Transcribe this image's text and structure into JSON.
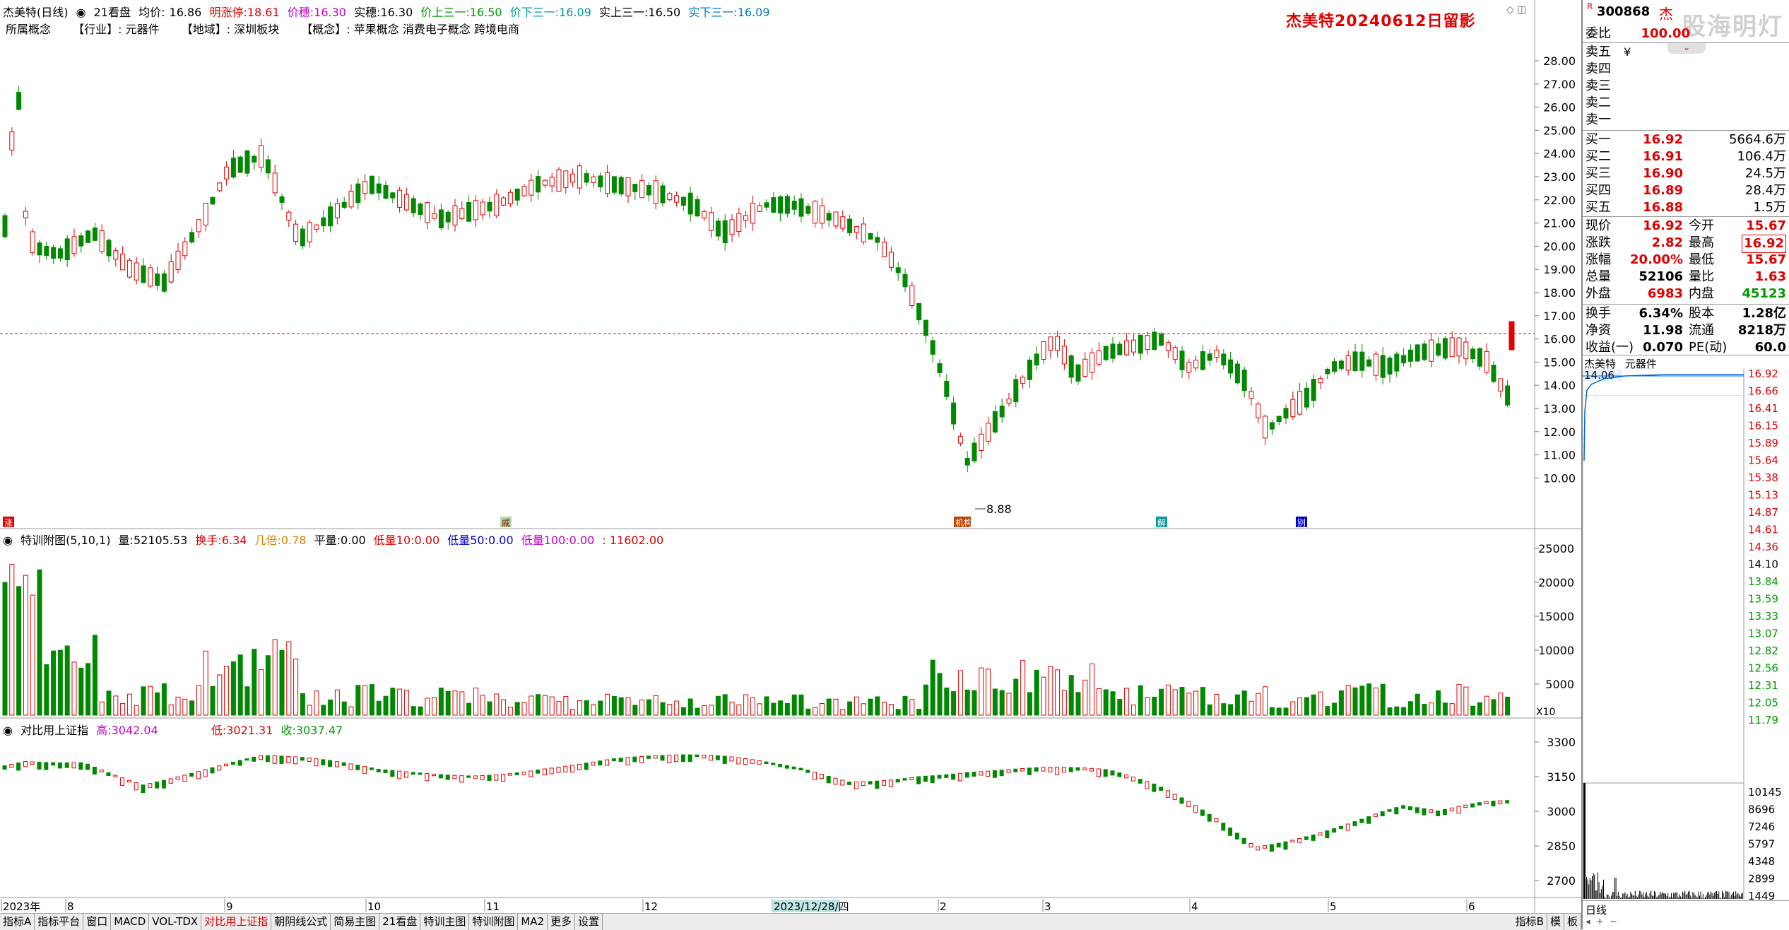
{
  "header": {
    "name": "杰美特(日线)",
    "tabs": "21看盘",
    "avg_label": "均价:",
    "avg": "16.86",
    "limit_label": "明涨停:",
    "limit": "18.61",
    "price_label": "价穗:",
    "price": "16.30",
    "real_label": "实穗:",
    "real": "16.30",
    "up3_label": "价上三一:",
    "up3": "16.50",
    "down3_label": "价下三一:",
    "down3": "16.09",
    "rup3_label": "实上三一:",
    "rup3": "16.50",
    "rdown3_label": "实下三一:",
    "rdown3": "16.09"
  },
  "info_tags": {
    "concept_tag": "所属概念",
    "industry": "【行业】: 元器件",
    "region": "【地域】: 深圳板块",
    "concepts": "【概念】: 苹果概念 消费电子概念 跨境电商"
  },
  "panel_title": "杰美特20240612日留影",
  "main_chart": {
    "y_ticks": [
      "28.00",
      "27.00",
      "26.00",
      "25.00",
      "24.00",
      "23.00",
      "22.00",
      "21.00",
      "20.00",
      "19.00",
      "18.00",
      "17.00",
      "16.00",
      "15.00",
      "14.00",
      "13.00",
      "12.00",
      "11.00",
      "10.00"
    ],
    "low_label": "8.88",
    "markers": [
      "涨",
      "戚",
      "机构",
      "解",
      "别"
    ]
  },
  "vol_header": {
    "title": "特训附图(5,10,1)",
    "vol_label": "量:",
    "vol": "52105.53",
    "turn_label": "换手:",
    "turn": "6.34",
    "times_label": "几倍:",
    "times": "0.78",
    "flat_label": "平量:",
    "flat": "0.00",
    "low10_label": "低量10:",
    "low10": "0.00",
    "low50_label": "低量50:",
    "low50": "0.00",
    "low100_label": "低量100:",
    "low100": "0.00",
    "v_tail": ": 11602.00",
    "y_ticks": [
      "25000",
      "20000",
      "15000",
      "10000",
      "5000"
    ],
    "unit": "X10"
  },
  "idx_header": {
    "title": "对比用上证指",
    "high_label": "高:",
    "high": "3042.04",
    "low_label": "低:",
    "low": "3021.31",
    "close_label": "收:",
    "close": "3037.47",
    "y_ticks": [
      "3300",
      "3150",
      "3000",
      "2850",
      "2700"
    ]
  },
  "x_axis": {
    "labels": [
      "2023年",
      "8",
      "9",
      "10",
      "11",
      "12",
      "2023/12/28/四",
      "2",
      "3",
      "4",
      "5",
      "6"
    ]
  },
  "bottom_tabs": [
    "指标A",
    "指标平台",
    "窗口",
    "MACD",
    "VOL-TDX",
    "对比用上证指",
    "朝阴线公式",
    "简易主图",
    "21看盘",
    "特训主图",
    "特训附图",
    "MA2",
    "更多",
    "设置"
  ],
  "bottom_right_tabs": [
    "指标B",
    "模",
    "板"
  ],
  "quote": {
    "code": "300868",
    "name": "杰",
    "watermark": "股海明灯",
    "ratio_label": "委比",
    "ratio": "100.00",
    "sell": [
      {
        "l": "卖五",
        "p": "",
        "v": ""
      },
      {
        "l": "卖四",
        "p": "",
        "v": ""
      },
      {
        "l": "卖三",
        "p": "",
        "v": ""
      },
      {
        "l": "卖二",
        "p": "",
        "v": ""
      },
      {
        "l": "卖一",
        "p": "",
        "v": ""
      }
    ],
    "buy": [
      {
        "l": "买一",
        "p": "16.92",
        "v": "5664.6万"
      },
      {
        "l": "买二",
        "p": "16.91",
        "v": "106.4万"
      },
      {
        "l": "买三",
        "p": "16.90",
        "v": "24.5万"
      },
      {
        "l": "买四",
        "p": "16.89",
        "v": "28.4万"
      },
      {
        "l": "买五",
        "p": "16.88",
        "v": "1.5万"
      }
    ],
    "stats": [
      {
        "l1": "现价",
        "v1": "16.92",
        "l2": "今开",
        "v2": "15.67"
      },
      {
        "l1": "涨跌",
        "v1": "2.82",
        "l2": "最高",
        "v2": "16.92"
      },
      {
        "l1": "涨幅",
        "v1": "20.00%",
        "l2": "最低",
        "v2": "15.67"
      },
      {
        "l1": "总量",
        "v1": "52106",
        "l2": "量比",
        "v2": "1.63"
      },
      {
        "l1": "外盘",
        "v1": "6983",
        "l2": "内盘",
        "v2": "45123"
      }
    ],
    "stats2": [
      {
        "l1": "换手",
        "v1": "6.34%",
        "l2": "股本",
        "v2": "1.28亿"
      },
      {
        "l1": "净资",
        "v1": "11.98",
        "l2": "流通",
        "v2": "8218万"
      },
      {
        "l1": "收益(一)",
        "v1": "0.070",
        "l2": "PE(动)",
        "v2": "60.0"
      }
    ],
    "mini_title": "杰美特",
    "mini_industry": "元器件",
    "mini_prev": "14.06",
    "mini_y_ticks": [
      "16.92",
      "16.66",
      "16.41",
      "16.15",
      "15.89",
      "15.64",
      "15.38",
      "15.13",
      "14.87",
      "14.61",
      "14.36",
      "14.10",
      "13.84",
      "13.59",
      "13.33",
      "13.07",
      "12.82",
      "12.56",
      "12.31",
      "12.05",
      "11.79"
    ],
    "mini_vol_ticks": [
      "10145",
      "8696",
      "7246",
      "5797",
      "4348",
      "2899",
      "1449"
    ],
    "mini_bottom": "日线"
  },
  "colors": {
    "up": "#e00000",
    "down": "#008800",
    "grid": "#c8c8c8"
  }
}
